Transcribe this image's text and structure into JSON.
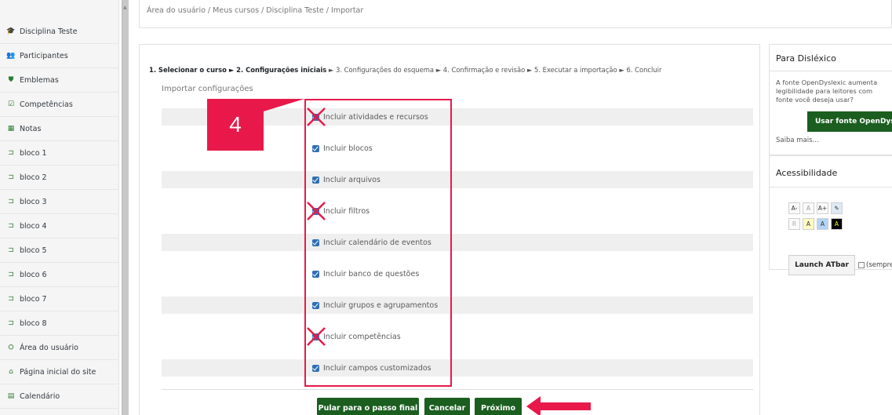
{
  "breadcrumb": "Área do usuário  /  Meus cursos  /  Disciplina Teste  /  Importar",
  "sidebar": {
    "items": [
      {
        "label": "Disciplina Teste",
        "icon": "graduation-cap-icon",
        "glyph": "🎓"
      },
      {
        "label": "Participantes",
        "icon": "users-icon",
        "glyph": "👥"
      },
      {
        "label": "Emblemas",
        "icon": "shield-icon",
        "glyph": "⛊"
      },
      {
        "label": "Competências",
        "icon": "check-square-icon",
        "glyph": "☑"
      },
      {
        "label": "Notas",
        "icon": "table-icon",
        "glyph": "▦"
      },
      {
        "label": "bloco 1",
        "icon": "folder-outline-icon",
        "glyph": "⊐"
      },
      {
        "label": "bloco 2",
        "icon": "folder-outline-icon",
        "glyph": "⊐"
      },
      {
        "label": "bloco 3",
        "icon": "folder-outline-icon",
        "glyph": "⊐"
      },
      {
        "label": "bloco 4",
        "icon": "folder-outline-icon",
        "glyph": "⊐"
      },
      {
        "label": "bloco 5",
        "icon": "folder-outline-icon",
        "glyph": "⊐"
      },
      {
        "label": "bloco 6",
        "icon": "folder-outline-icon",
        "glyph": "⊐"
      },
      {
        "label": "bloco 7",
        "icon": "folder-outline-icon",
        "glyph": "⊐"
      },
      {
        "label": "bloco 8",
        "icon": "folder-outline-icon",
        "glyph": "⊐"
      },
      {
        "label": "Área do usuário",
        "icon": "dashboard-icon",
        "glyph": "⛭"
      },
      {
        "label": "Página inicial do site",
        "icon": "home-icon",
        "glyph": "⌂"
      },
      {
        "label": "Calendário",
        "icon": "calendar-icon",
        "glyph": "▤"
      }
    ]
  },
  "stepper": {
    "steps_bold": "1. Selecionar o curso ► 2. Configurações iniciais",
    "steps_rest": " ► 3. Configurações do esquema ► 4. Confirmação e revisão ► 5. Executar a importação ► 6. Concluir"
  },
  "section_title": "Importar configurações",
  "options": [
    {
      "label": "Incluir atividades e recursos",
      "checked": true
    },
    {
      "label": "Incluir blocos",
      "checked": true
    },
    {
      "label": "Incluir arquivos",
      "checked": true
    },
    {
      "label": "Incluir filtros",
      "checked": true
    },
    {
      "label": "Incluir calendário de eventos",
      "checked": true
    },
    {
      "label": "Incluir banco de questões",
      "checked": true
    },
    {
      "label": "Incluir grupos e agrupamentos",
      "checked": true
    },
    {
      "label": "Incluir competências",
      "checked": true
    },
    {
      "label": "Incluir campos customizados",
      "checked": true
    }
  ],
  "buttons": {
    "skip": "Pular para o passo final",
    "cancel": "Cancelar",
    "next": "Próximo"
  },
  "annotation": {
    "number": "4",
    "color": "#e8194a"
  },
  "dyslexic_block": {
    "title": "Para Disléxico",
    "desc_line1": "A fonte OpenDyslexic aumenta",
    "desc_line2": "legibilidade para leitores com",
    "desc_line3": "fonte você deseja usar?",
    "button": "Usar fonte OpenDyslexic",
    "more": "Saiba mais..."
  },
  "accessibility_block": {
    "title": "Acessibilidade",
    "row1": [
      "A-",
      "A",
      "A+"
    ],
    "row2": [
      "R",
      "A",
      "A",
      "A"
    ],
    "launch": "Launch ATbar",
    "always": "(sempre)"
  },
  "colors": {
    "accent_green": "#1b5e20",
    "checkbox_blue": "#2f6fb7"
  }
}
